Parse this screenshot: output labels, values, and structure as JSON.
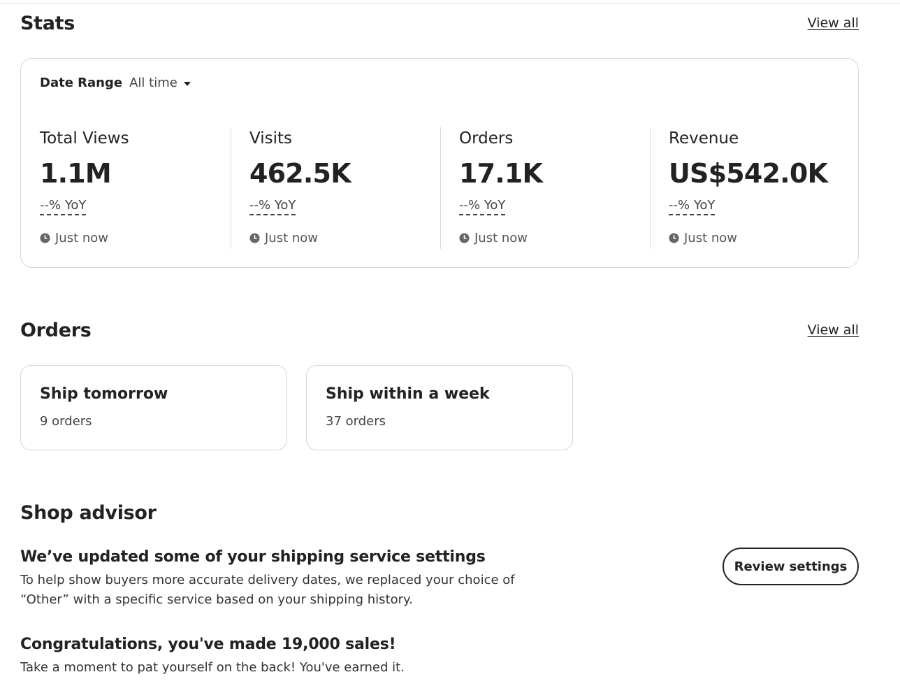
{
  "stats": {
    "title": "Stats",
    "view_all": "View all",
    "date_range_label": "Date Range",
    "date_range_value": "All time",
    "metrics": [
      {
        "label": "Total Views",
        "value": "1.1M",
        "yoy": "--% YoY",
        "updated": "Just now"
      },
      {
        "label": "Visits",
        "value": "462.5K",
        "yoy": "--% YoY",
        "updated": "Just now"
      },
      {
        "label": "Orders",
        "value": "17.1K",
        "yoy": "--% YoY",
        "updated": "Just now"
      },
      {
        "label": "Revenue",
        "value": "US$542.0K",
        "yoy": "--% YoY",
        "updated": "Just now"
      }
    ]
  },
  "orders": {
    "title": "Orders",
    "view_all": "View all",
    "cards": [
      {
        "title": "Ship tomorrow",
        "count": "9 orders"
      },
      {
        "title": "Ship within a week",
        "count": "37 orders"
      }
    ]
  },
  "advisor": {
    "title": "Shop advisor",
    "items": [
      {
        "title": "We’ve updated some of your shipping service settings",
        "line1": "To help show buyers more accurate delivery dates, we replaced your choice of",
        "line2": "“Other” with a specific service based on your shipping history.",
        "button": "Review settings"
      },
      {
        "title": "Congratulations, you've made 19,000 sales!",
        "line1": "Take a moment to pat yourself on the back! You've earned it."
      }
    ]
  },
  "colors": {
    "text": "#222222",
    "muted": "#555555",
    "border": "#d6d6d6"
  }
}
